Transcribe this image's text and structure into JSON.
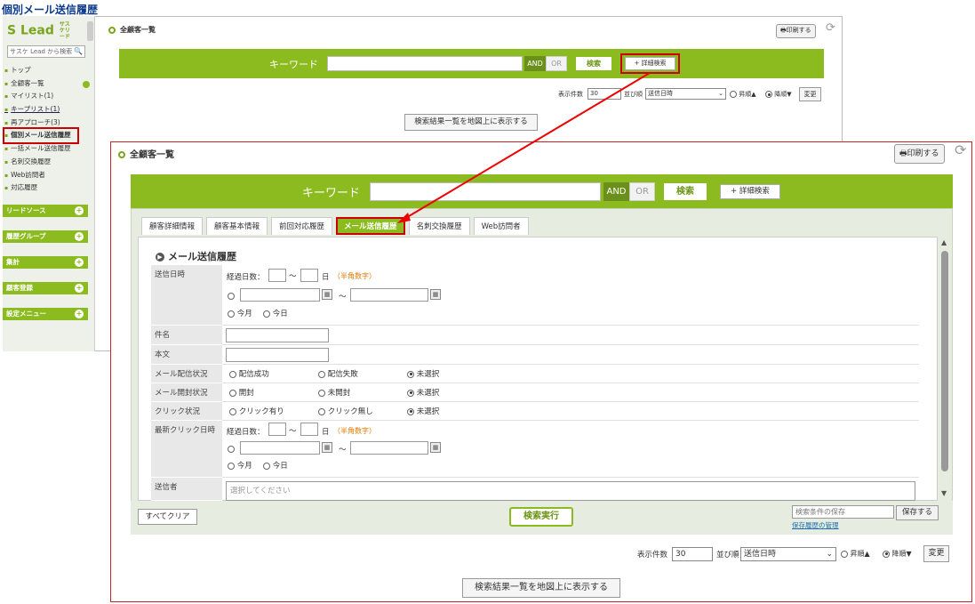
{
  "page_title": "個別メール送信履歴",
  "sidebar": {
    "logo": "Lead",
    "logo_sub": "サスケリード",
    "search_placeholder": "サスケ Lead から検索",
    "items": [
      "トップ",
      "全顧客一覧",
      "マイリスト(1)",
      "キープリスト(1)",
      "再アプローチ(3)",
      "個別メール送信履歴",
      "一括メール送信履歴",
      "名刺交換履歴",
      "Web訪問者",
      "対応履歴"
    ],
    "sections": [
      "リードソース",
      "履歴グループ",
      "集計",
      "顧客登録",
      "設定メニュー"
    ]
  },
  "back": {
    "header": "全顧客一覧",
    "print": "印刷する",
    "keyword": "キーワード",
    "and": "AND",
    "or": "OR",
    "search": "検索",
    "detail": "+ 詳細検索",
    "count_label": "表示件数",
    "count": "30",
    "sort_label": "並び順",
    "sort_value": "送信日時",
    "asc": "昇順▲",
    "desc": "降順▼",
    "change": "変更",
    "map_button": "検索結果一覧を地図上に表示する"
  },
  "front": {
    "header": "全顧客一覧",
    "print": "印刷する",
    "keyword": "キーワード",
    "and": "AND",
    "or": "OR",
    "search": "検索",
    "detail": "+ 詳細検索",
    "tabs": [
      "顧客詳細情報",
      "顧客基本情報",
      "前回対応履歴",
      "メール送信履歴",
      "名刺交換履歴",
      "Web訪問者"
    ],
    "section_title": "メール送信履歴",
    "fields": {
      "send_date": "送信日時",
      "elapsed": "経過日数：",
      "tilde": "～",
      "day": "日",
      "half_num": "（半角数字）",
      "this_month": "今月",
      "today": "今日",
      "subject": "件名",
      "body": "本文",
      "delivery": "メール配信状況",
      "delivery_ok": "配信成功",
      "delivery_ng": "配信失敗",
      "unselected": "未選択",
      "open": "メール開封状況",
      "opened": "開封",
      "unopened": "未開封",
      "click": "クリック状況",
      "clicked": "クリック有り",
      "no_click": "クリック無し",
      "last_click": "最新クリック日時",
      "sender": "送信者",
      "sender_placeholder": "選択してください"
    },
    "clear_all": "すべてクリア",
    "execute": "検索実行",
    "save_placeholder": "検索条件の保存",
    "save_button": "保存する",
    "save_link": "保存履歴の管理",
    "count_label": "表示件数",
    "count": "30",
    "sort_label": "並び順",
    "sort_value": "送信日時",
    "asc": "昇順▲",
    "desc": "降順▼",
    "change": "変更",
    "map_button": "検索結果一覧を地図上に表示する"
  },
  "colors": {
    "accent": "#8cbb1f",
    "highlight": "#cc0000"
  }
}
